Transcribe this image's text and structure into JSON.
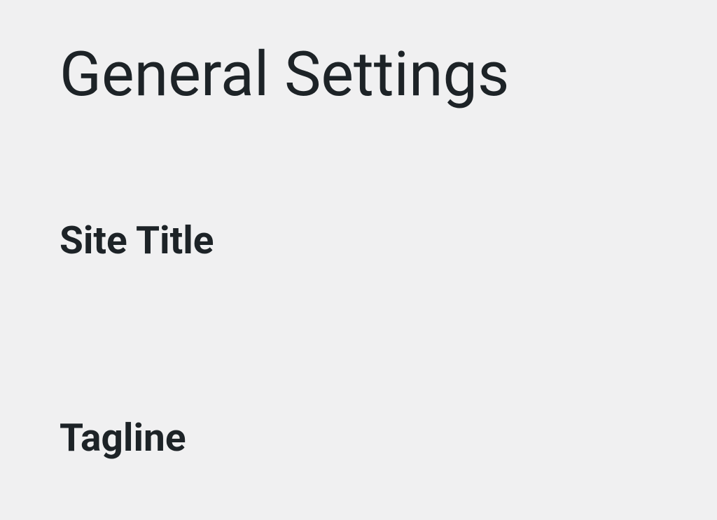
{
  "page": {
    "title": "General Settings"
  },
  "fields": {
    "site_title": {
      "label": "Site Title"
    },
    "tagline": {
      "label": "Tagline"
    }
  }
}
